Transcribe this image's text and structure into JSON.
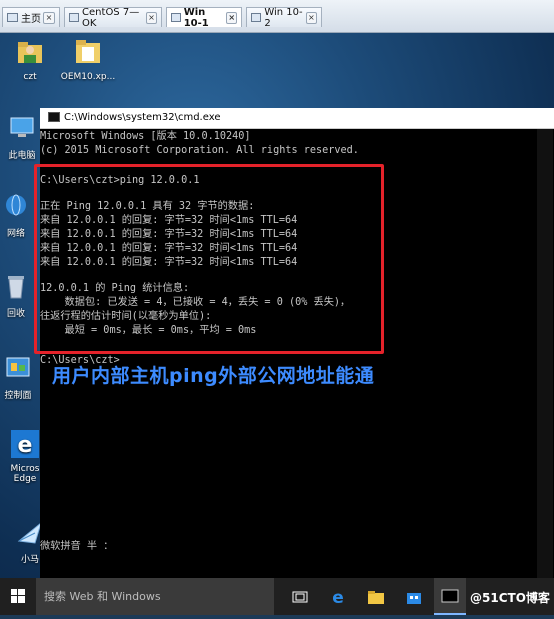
{
  "tabs": [
    {
      "label": "主页",
      "active": false
    },
    {
      "label": "CentOS 7—OK",
      "active": false
    },
    {
      "label": "Win 10-1",
      "active": true
    },
    {
      "label": "Win 10-2",
      "active": false
    }
  ],
  "desktop_icons": [
    {
      "label": "czt",
      "icon": "user-folder-icon"
    },
    {
      "label": "OEM10.xp...",
      "icon": "file-icon"
    },
    {
      "label": "此电脑",
      "icon": "computer-icon"
    },
    {
      "label": "网络",
      "icon": "network-icon"
    },
    {
      "label": "回收",
      "icon": "recycle-bin-icon"
    },
    {
      "label": "控制面",
      "icon": "control-panel-icon"
    },
    {
      "label": "Micros Edge",
      "icon": "edge-icon"
    },
    {
      "label": "小马",
      "icon": "activator-icon"
    }
  ],
  "cmd": {
    "title": "C:\\Windows\\system32\\cmd.exe",
    "lines": [
      "Microsoft Windows [版本 10.0.10240]",
      "(c) 2015 Microsoft Corporation. All rights reserved.",
      "",
      "C:\\Users\\czt>ping 12.0.0.1",
      "",
      "正在 Ping 12.0.0.1 具有 32 字节的数据:",
      "来自 12.0.0.1 的回复: 字节=32 时间<1ms TTL=64",
      "来自 12.0.0.1 的回复: 字节=32 时间<1ms TTL=64",
      "来自 12.0.0.1 的回复: 字节=32 时间<1ms TTL=64",
      "来自 12.0.0.1 的回复: 字节=32 时间<1ms TTL=64",
      "",
      "12.0.0.1 的 Ping 统计信息:",
      "    数据包: 已发送 = 4，已接收 = 4，丢失 = 0 (0% 丢失)，",
      "往返行程的估计时间(以毫秒为单位):",
      "    最短 = 0ms，最长 = 0ms，平均 = 0ms",
      "",
      "C:\\Users\\czt>"
    ],
    "ime_status": "微软拼音 半 ："
  },
  "annotation": "用户内部主机ping外部公网地址能通",
  "taskbar": {
    "search_placeholder": "搜索 Web 和 Windows",
    "watermark": "@51CTO博客"
  },
  "colors": {
    "highlight_box": "#e5222a",
    "annotation_text": "#3d8bff"
  }
}
